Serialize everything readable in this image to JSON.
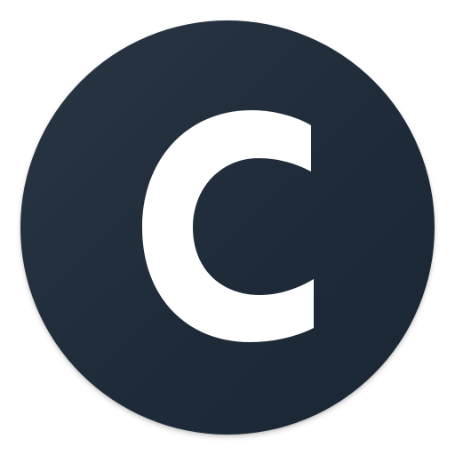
{
  "icon": {
    "name": "c-letter-logo",
    "background_color": "#1f2b39",
    "glyph_color": "#ffffff"
  }
}
